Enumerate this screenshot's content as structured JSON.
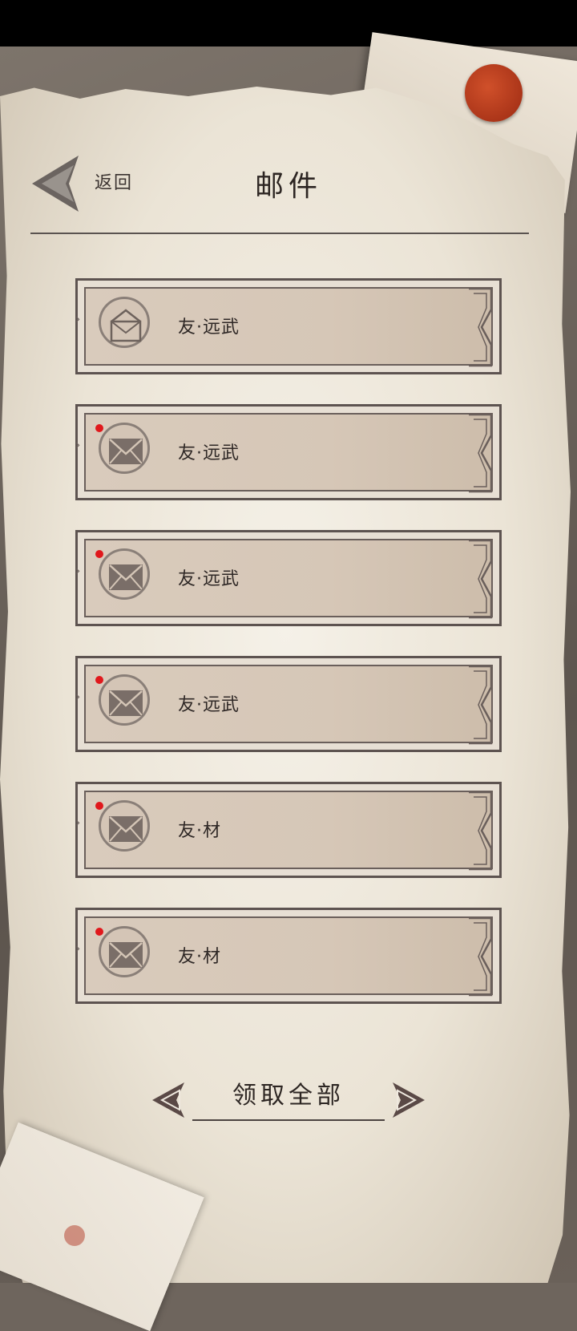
{
  "header": {
    "back_label": "返回",
    "title": "邮件"
  },
  "mails": [
    {
      "sender": "友·远武",
      "unread": false,
      "icon": "envelope-open-icon"
    },
    {
      "sender": "友·远武",
      "unread": true,
      "icon": "envelope-closed-icon"
    },
    {
      "sender": "友·远武",
      "unread": true,
      "icon": "envelope-closed-icon"
    },
    {
      "sender": "友·远武",
      "unread": true,
      "icon": "envelope-closed-icon"
    },
    {
      "sender": "友·材",
      "unread": true,
      "icon": "envelope-closed-icon"
    },
    {
      "sender": "友·材",
      "unread": true,
      "icon": "envelope-closed-icon"
    }
  ],
  "footer": {
    "claim_all_label": "领取全部"
  },
  "colors": {
    "unread_dot": "#e0181c",
    "seal": "#b83a1c",
    "frame": "#5d5350"
  }
}
